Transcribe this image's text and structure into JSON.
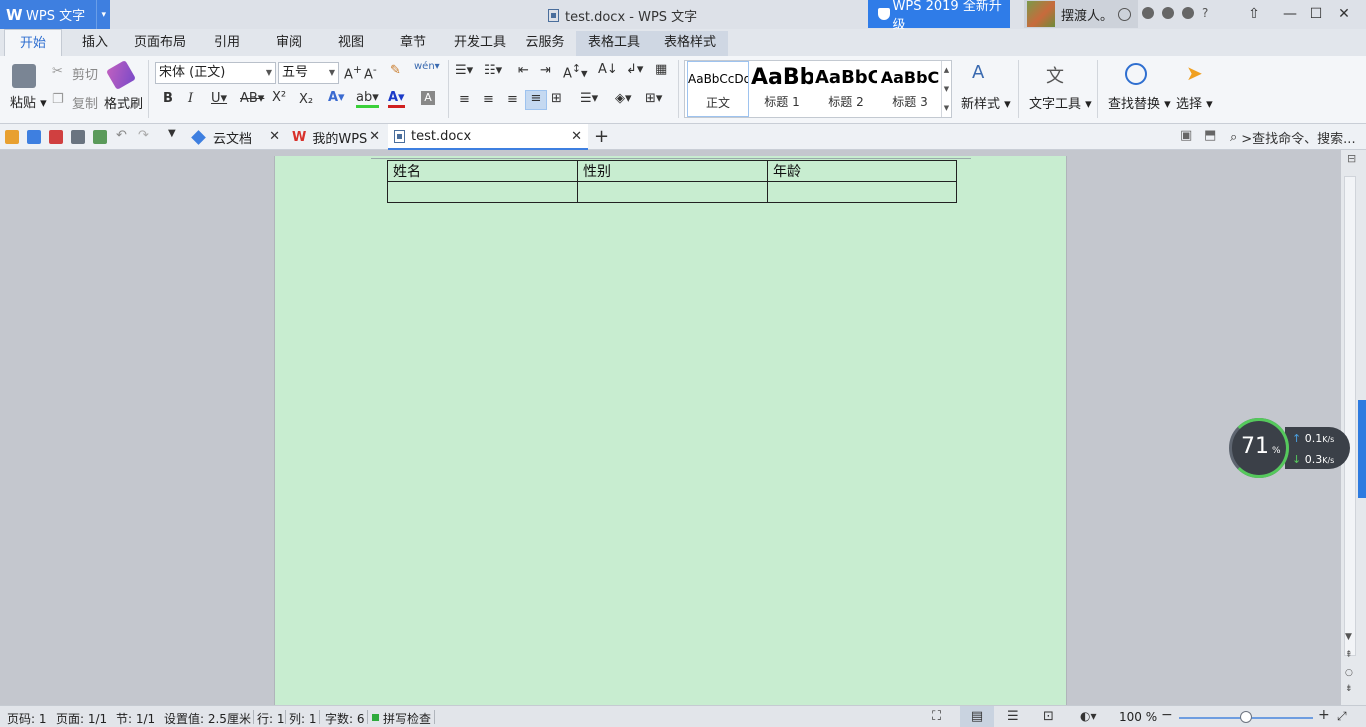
{
  "app": {
    "logo_letter": "W",
    "name": "WPS 文字",
    "dropdown_arrow": "▾"
  },
  "window": {
    "title": "test.docx - WPS 文字",
    "minimize": "—",
    "restore": "☐",
    "close": "✕"
  },
  "upgrade_banner": "WPS 2019 全新升级",
  "user": {
    "name": "摆渡人。"
  },
  "menu_tabs": [
    "开始",
    "插入",
    "页面布局",
    "引用",
    "审阅",
    "视图",
    "章节",
    "开发工具",
    "云服务",
    "表格工具",
    "表格样式"
  ],
  "ribbon": {
    "paste": "粘贴",
    "cut": "剪切",
    "copy": "复制",
    "format_painter": "格式刷",
    "font_name": "宋体 (正文)",
    "font_size": "五号",
    "styles": [
      {
        "preview": "AaBbCcDd",
        "name": "正文"
      },
      {
        "preview": "AaBb",
        "name": "标题 1"
      },
      {
        "preview": "AaBbC",
        "name": "标题 2"
      },
      {
        "preview": "AaBbC",
        "name": "标题 3"
      }
    ],
    "new_style": "新样式",
    "text_tools": "文字工具",
    "find_replace": "查找替换",
    "select": "选择"
  },
  "doc_tabs": [
    {
      "label": "云文档"
    },
    {
      "label": "我的WPS"
    },
    {
      "label": "test.docx"
    }
  ],
  "search_placeholder": ">查找命令、搜索...",
  "document": {
    "table": [
      [
        "姓名",
        "性别",
        "年龄"
      ],
      [
        "",
        "",
        ""
      ]
    ]
  },
  "speed_widget": {
    "percent": "71",
    "percent_unit": "%",
    "upload": "0.1",
    "download": "0.3",
    "unit": "K/s"
  },
  "status_bar": {
    "page_num": "页码: 1",
    "pages": "页面: 1/1",
    "section": "节: 1/1",
    "setting": "设置值: 2.5厘米",
    "row": "行: 1",
    "col": "列: 1",
    "word_count": "字数: 6",
    "spell_check": "拼写检查",
    "zoom": "100 %"
  }
}
